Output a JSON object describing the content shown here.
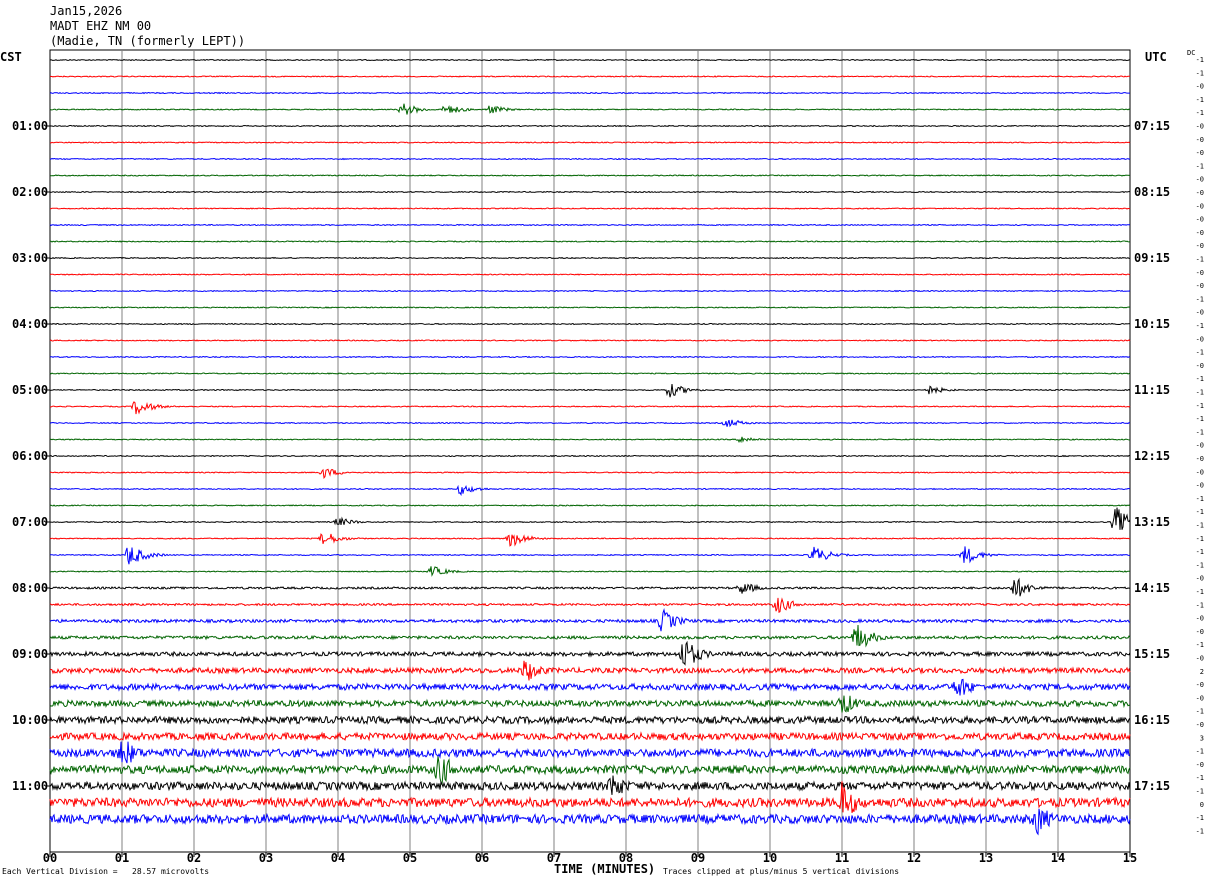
{
  "header": {
    "date": "Jan15,2026",
    "station": "MADT EHZ NM 00",
    "location": "(Madie, TN (formerly LEPT))"
  },
  "axis": {
    "left_label": "CST",
    "right_label": "UTC",
    "dc_label": "DC",
    "x_title": "TIME (MINUTES)"
  },
  "footer": {
    "scale_note": "Each Vertical Division =   28.57 microvolts",
    "clip_note": "Traces clipped at plus/minus 5 vertical divisions"
  },
  "colors": {
    "cycle": [
      "#000000",
      "#ff0000",
      "#0000ff",
      "#006400"
    ],
    "grid": "#808080"
  },
  "chart_data": {
    "type": "line",
    "title": "",
    "x_ticks": [
      "00",
      "01",
      "02",
      "03",
      "04",
      "05",
      "06",
      "07",
      "08",
      "09",
      "10",
      "11",
      "12",
      "13",
      "14",
      "15"
    ],
    "xlim": [
      0,
      15
    ],
    "lines_per_hour": 4,
    "left_hour_labels": [
      "01:00",
      "02:00",
      "03:00",
      "04:00",
      "05:00",
      "06:00",
      "07:00",
      "08:00",
      "09:00",
      "10:00",
      "11:00"
    ],
    "right_hour_labels": [
      "07:15",
      "08:15",
      "09:15",
      "10:15",
      "11:15",
      "12:15",
      "13:15",
      "14:15",
      "15:15",
      "16:15",
      "17:15"
    ],
    "dc_offsets": [
      "-1",
      "-1",
      "-0",
      "-1",
      "-1",
      "-0",
      "-0",
      "-0",
      "-1",
      "-0",
      "-0",
      "-0",
      "-0",
      "-0",
      "-0",
      "-1",
      "-0",
      "-0",
      "-1",
      "-0",
      "-1",
      "-0",
      "-1",
      "-0",
      "-1",
      "-1",
      "-1",
      "-1",
      "-1",
      "-0",
      "-0",
      "-0",
      "-0",
      "-1",
      "-1",
      "-1",
      "-1",
      "-1",
      "-1",
      "-0",
      "-1",
      "-1",
      "-0",
      "-0",
      "-1",
      "-0",
      "2",
      "-0",
      "-0",
      "-1",
      "-0",
      "3",
      "-1",
      "-0",
      "-1",
      "-1",
      "0",
      "-1",
      "-1"
    ],
    "trace_count": 47,
    "noise_level": [
      1,
      1,
      1,
      1,
      1,
      1,
      1,
      1,
      1,
      1,
      1,
      1,
      1,
      1,
      1,
      1,
      1,
      1,
      1,
      1,
      1,
      1,
      1,
      1,
      1,
      1,
      1,
      1,
      1,
      1,
      1,
      1,
      2,
      2,
      3,
      3,
      4,
      5,
      6,
      6,
      7,
      7,
      8,
      8,
      8,
      9,
      9
    ],
    "events": [
      {
        "row": 3,
        "minute": 4.9,
        "amp": 7
      },
      {
        "row": 3,
        "minute": 5.5,
        "amp": 6
      },
      {
        "row": 3,
        "minute": 6.1,
        "amp": 5
      },
      {
        "row": 20,
        "minute": 8.6,
        "amp": 8
      },
      {
        "row": 20,
        "minute": 12.2,
        "amp": 5
      },
      {
        "row": 21,
        "minute": 1.2,
        "amp": 9
      },
      {
        "row": 22,
        "minute": 9.4,
        "amp": 5
      },
      {
        "row": 23,
        "minute": 9.6,
        "amp": 4
      },
      {
        "row": 25,
        "minute": 3.8,
        "amp": 6
      },
      {
        "row": 26,
        "minute": 5.7,
        "amp": 6
      },
      {
        "row": 28,
        "minute": 14.8,
        "amp": 16
      },
      {
        "row": 28,
        "minute": 4.0,
        "amp": 5
      },
      {
        "row": 29,
        "minute": 3.8,
        "amp": 8
      },
      {
        "row": 29,
        "minute": 6.4,
        "amp": 9
      },
      {
        "row": 30,
        "minute": 1.1,
        "amp": 12
      },
      {
        "row": 30,
        "minute": 10.6,
        "amp": 10
      },
      {
        "row": 30,
        "minute": 12.7,
        "amp": 10
      },
      {
        "row": 31,
        "minute": 5.3,
        "amp": 6
      },
      {
        "row": 32,
        "minute": 13.4,
        "amp": 12
      },
      {
        "row": 32,
        "minute": 9.6,
        "amp": 7
      },
      {
        "row": 33,
        "minute": 10.1,
        "amp": 10
      },
      {
        "row": 34,
        "minute": 8.5,
        "amp": 13
      },
      {
        "row": 35,
        "minute": 11.2,
        "amp": 16
      },
      {
        "row": 36,
        "minute": 8.8,
        "amp": 18
      },
      {
        "row": 37,
        "minute": 6.6,
        "amp": 14
      },
      {
        "row": 38,
        "minute": 12.6,
        "amp": 14
      },
      {
        "row": 39,
        "minute": 11.0,
        "amp": 14
      },
      {
        "row": 42,
        "minute": 1.0,
        "amp": 18
      },
      {
        "row": 43,
        "minute": 5.4,
        "amp": 20
      },
      {
        "row": 44,
        "minute": 7.8,
        "amp": 16
      },
      {
        "row": 45,
        "minute": 11.0,
        "amp": 22
      },
      {
        "row": 46,
        "minute": 13.7,
        "amp": 18
      }
    ]
  }
}
